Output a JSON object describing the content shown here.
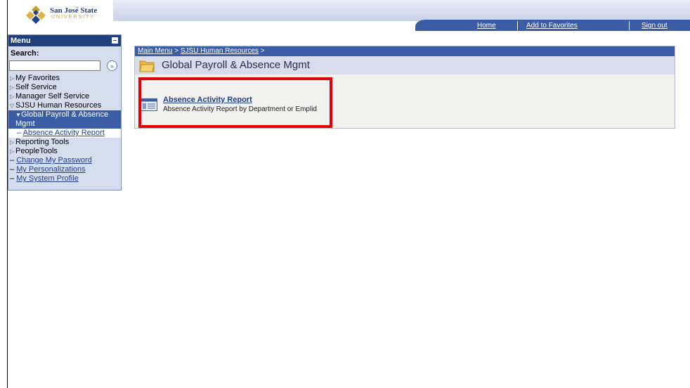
{
  "header": {
    "logo_name": "San José State",
    "logo_sub": "UNIVERSITY",
    "links": [
      "Home",
      "Add to Favorites",
      "Sign out"
    ]
  },
  "menu": {
    "title": "Menu",
    "search_label": "Search:",
    "search_value": "",
    "items": [
      {
        "label": "My Favorites"
      },
      {
        "label": "Self Service"
      },
      {
        "label": "Manager Self Service"
      },
      {
        "label": "SJSU Human Resources"
      }
    ],
    "selected_line1": "Global Payroll & Absence",
    "selected_line2": "Mgmt",
    "sub_item": "Absence Activity Report",
    "items_after": [
      {
        "label": "Reporting Tools"
      },
      {
        "label": "PeopleTools"
      }
    ],
    "links": [
      "Change My Password",
      "My Personalizations",
      "My System Profile"
    ]
  },
  "content": {
    "breadcrumb": [
      "Main Menu",
      "SJSU Human Resources"
    ],
    "title": "Global Payroll & Absence Mgmt",
    "cref_label": "Absence Activity Report",
    "cref_desc": "Absence Activity Report by Department or Emplid"
  },
  "colors": {
    "accent": "#3b5da6",
    "highlight": "#e30000"
  }
}
